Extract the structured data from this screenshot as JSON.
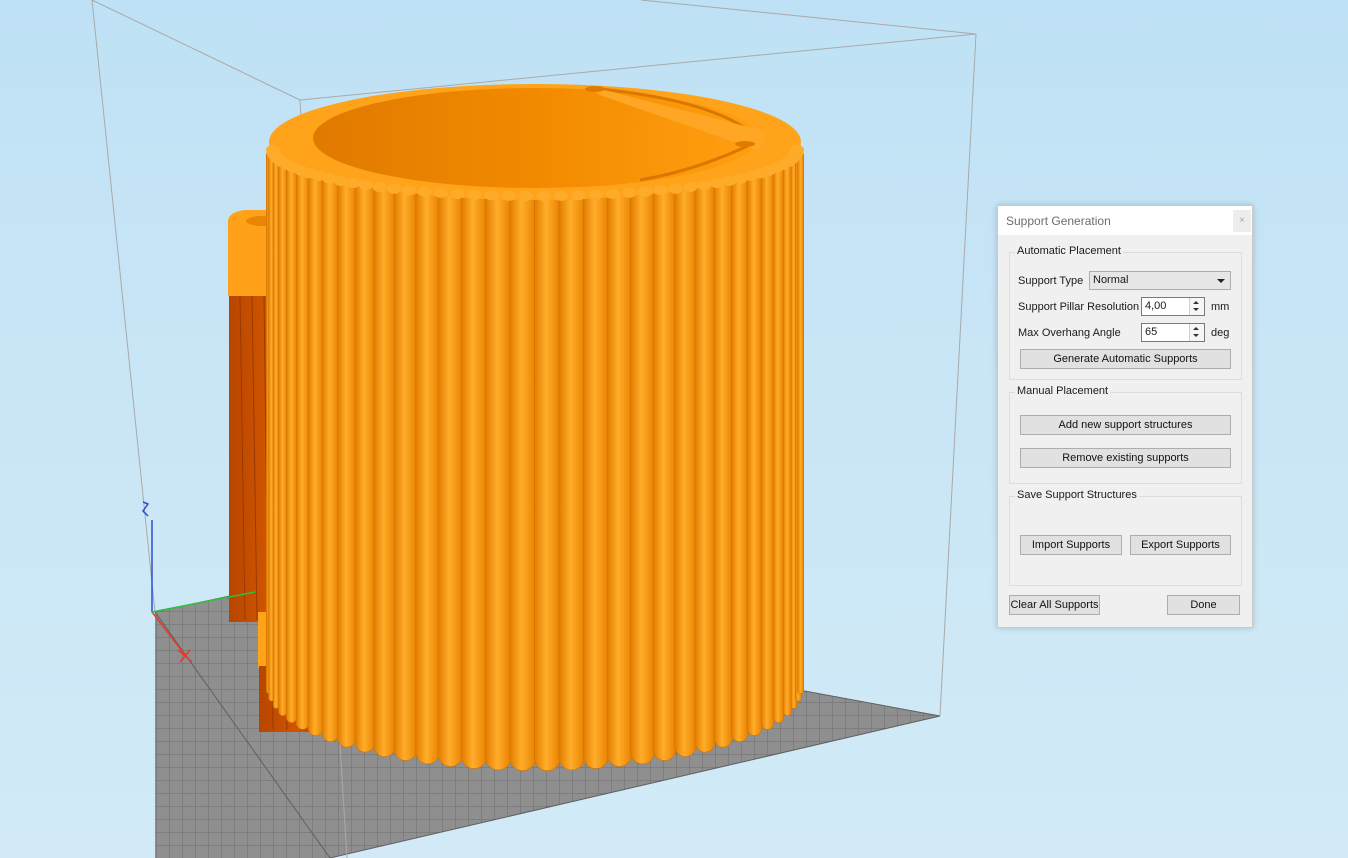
{
  "dialog": {
    "title": "Support Generation",
    "close_glyph": "×",
    "automatic": {
      "group_title": "Automatic Placement",
      "support_type_label": "Support Type",
      "support_type_value": "Normal",
      "pillar_resolution_label": "Support Pillar Resolution",
      "pillar_resolution_value": "4,00",
      "pillar_resolution_unit": "mm",
      "overhang_label": "Max Overhang Angle",
      "overhang_value": "65",
      "overhang_unit": "deg",
      "generate_button": "Generate Automatic Supports"
    },
    "manual": {
      "group_title": "Manual Placement",
      "add_button": "Add new support structures",
      "remove_button": "Remove existing supports"
    },
    "save": {
      "group_title": "Save Support Structures",
      "import_button": "Import Supports",
      "export_button": "Export Supports"
    },
    "clear_button": "Clear All Supports",
    "done_button": "Done"
  },
  "colors": {
    "model": "#ff9a00",
    "support": "#c94e00",
    "build_plate": "#8a8a8a",
    "axis_x": "#e23b2f",
    "axis_y": "#2fbf3a",
    "axis_z": "#2c4fd6"
  }
}
